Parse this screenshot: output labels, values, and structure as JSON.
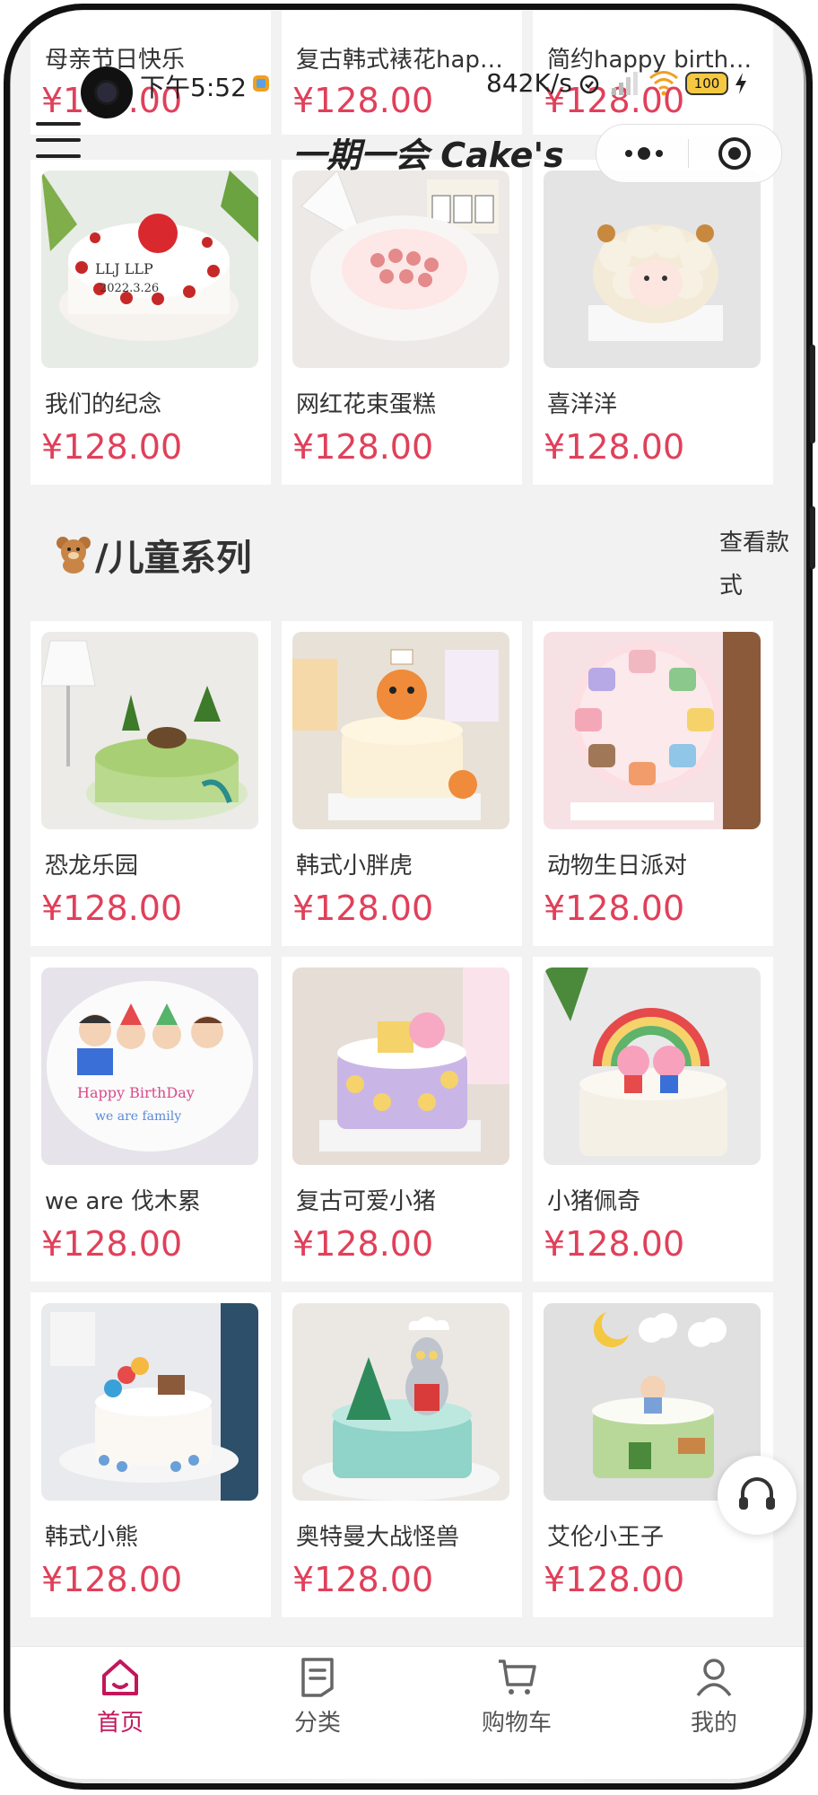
{
  "status": {
    "time": "下午5:52",
    "speed": "842K/s",
    "battery": "100"
  },
  "header": {
    "brand": "一期一会 Cake's"
  },
  "top_row": [
    {
      "name": "母亲节日快乐",
      "price": "¥128.00"
    },
    {
      "name": "复古韩式裱花hap…",
      "price": "¥128.00"
    },
    {
      "name": "简约happy birth…",
      "price": "¥128.00"
    }
  ],
  "row1": [
    {
      "name": "我们的纪念",
      "price": "¥128.00"
    },
    {
      "name": "网红花束蛋糕",
      "price": "¥128.00"
    },
    {
      "name": "喜洋洋",
      "price": "¥128.00"
    }
  ],
  "section": {
    "title": "/儿童系列",
    "more": "查看款式"
  },
  "kids": [
    {
      "name": "恐龙乐园",
      "price": "¥128.00"
    },
    {
      "name": "韩式小胖虎",
      "price": "¥128.00"
    },
    {
      "name": "动物生日派对",
      "price": "¥128.00"
    },
    {
      "name": "we are 伐木累",
      "price": "¥128.00"
    },
    {
      "name": "复古可爱小猪",
      "price": "¥128.00"
    },
    {
      "name": "小猪佩奇",
      "price": "¥128.00"
    },
    {
      "name": "韩式小熊",
      "price": "¥128.00"
    },
    {
      "name": "奥特曼大战怪兽",
      "price": "¥128.00"
    },
    {
      "name": "艾伦小王子",
      "price": "¥128.00"
    }
  ],
  "tabbar": [
    {
      "label": "首页",
      "icon": "home-icon",
      "active": true
    },
    {
      "label": "分类",
      "icon": "category-icon",
      "active": false
    },
    {
      "label": "购物车",
      "icon": "cart-icon",
      "active": false
    },
    {
      "label": "我的",
      "icon": "profile-icon",
      "active": false
    }
  ],
  "colors": {
    "accent": "#c2185b",
    "price": "#e0405a",
    "background": "#f2f2f2"
  }
}
